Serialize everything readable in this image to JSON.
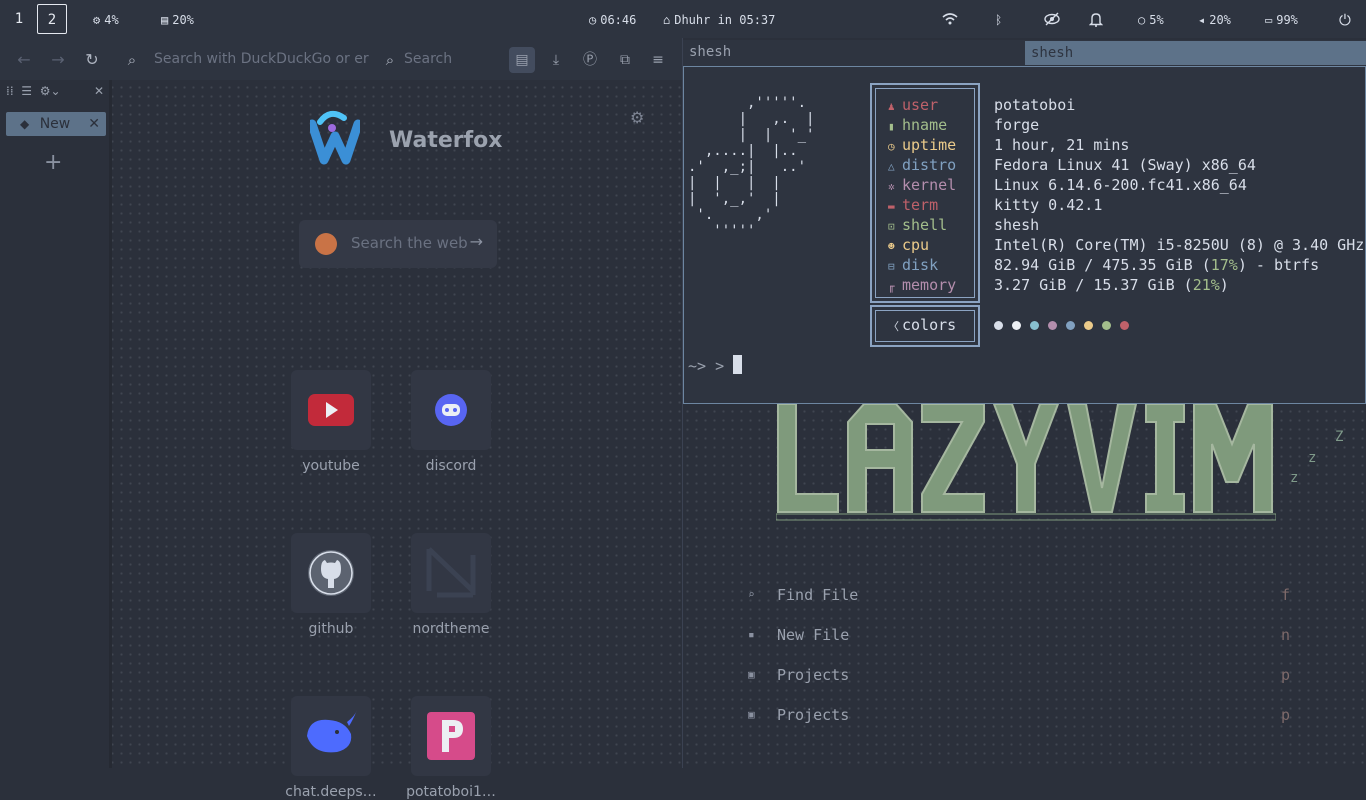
{
  "topbar": {
    "workspaces": [
      "1",
      "2"
    ],
    "cpu": "4%",
    "ram": "20%",
    "clock": "06:46",
    "prayer": "Dhuhr in 05:37",
    "brightness": "5%",
    "volume": "20%",
    "battery": "99%"
  },
  "browser": {
    "url_placeholder": "Search with DuckDuckGo or er",
    "search_placeholder": "Search",
    "tab_label": "New",
    "brand": "Waterfox",
    "ntp_search_placeholder": "Search the web",
    "sites": [
      {
        "label": "youtube",
        "color": "#c22a3a"
      },
      {
        "label": "discord",
        "color": "#5865f2"
      },
      {
        "label": "github",
        "color": "#5c6370"
      },
      {
        "label": "nordtheme",
        "color": "#3b4252"
      },
      {
        "label": "chat.deeps…",
        "color": "#4d6bfe"
      },
      {
        "label": "potatoboi1…",
        "color": "#d64b8a"
      }
    ]
  },
  "terminal": {
    "title": "shesh",
    "title_focused": "shesh",
    "info": [
      {
        "key": "user",
        "value": "potatoboi",
        "color": "#bf616a"
      },
      {
        "key": "hname",
        "value": "forge",
        "color": "#a3be8c"
      },
      {
        "key": "uptime",
        "value": "1 hour, 21 mins",
        "color": "#ebcb8b"
      },
      {
        "key": "distro",
        "value": "Fedora Linux 41 (Sway) x86_64",
        "color": "#81a1c1"
      },
      {
        "key": "kernel",
        "value": "Linux 6.14.6-200.fc41.x86_64",
        "color": "#b48ead"
      },
      {
        "key": "term",
        "value": "kitty 0.42.1",
        "color": "#bf616a"
      },
      {
        "key": "shell",
        "value": "shesh",
        "color": "#a3be8c"
      },
      {
        "key": "cpu",
        "value": "Intel(R) Core(TM) i5-8250U (8) @ 3.40 GHz",
        "color": "#ebcb8b"
      },
      {
        "key": "disk",
        "value_pre": "82.94 GiB / 475.35 GiB (",
        "value_hl": "17%",
        "value_post": ") - btrfs",
        "color": "#81a1c1"
      },
      {
        "key": "memory",
        "value_pre": "3.27 GiB / 15.37 GiB (",
        "value_hl": "21%",
        "value_post": ")",
        "color": "#b48ead"
      }
    ],
    "colors_label": "colors",
    "palette": [
      "#d8dee9",
      "#eceff4",
      "#88c0d0",
      "#b48ead",
      "#81a1c1",
      "#ebcb8b",
      "#a3be8c",
      "#bf616a"
    ],
    "prompt": "~> >"
  },
  "lazyvim": {
    "logo": "LAZYVIM",
    "zz": [
      "Z",
      "z",
      "z"
    ],
    "menu": [
      {
        "label": "Find File",
        "key": "f"
      },
      {
        "label": "New File",
        "key": "n"
      },
      {
        "label": "Projects",
        "key": "p"
      },
      {
        "label": "Projects",
        "key": "p"
      }
    ]
  }
}
